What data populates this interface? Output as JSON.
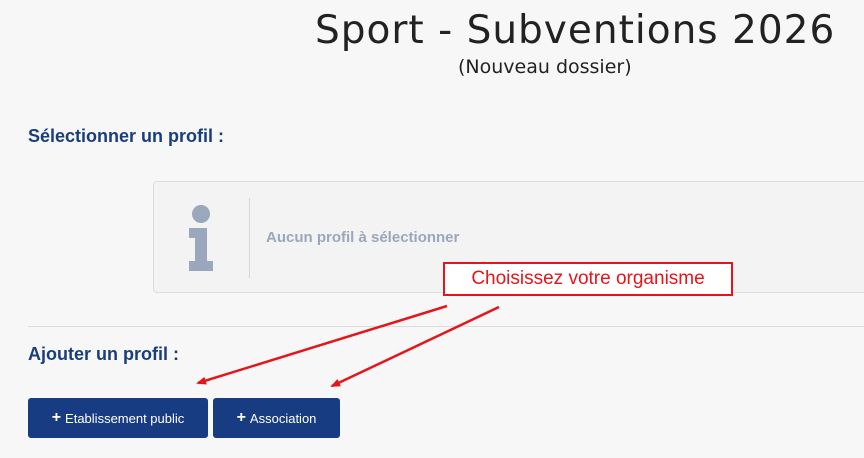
{
  "header": {
    "title": "Sport - Subventions 2026",
    "subtitle": "(Nouveau dossier)"
  },
  "select_profile": {
    "heading": "Sélectionner un profil :",
    "empty_message": "Aucun profil à sélectionner",
    "icon": "info-icon"
  },
  "add_profile": {
    "heading": "Ajouter un profil :",
    "buttons": [
      {
        "label": "Etablissement public",
        "icon": "plus-icon"
      },
      {
        "label": "Association",
        "icon": "plus-icon"
      }
    ]
  },
  "annotation": {
    "callout_text": "Choisissez votre organisme",
    "color": "#e3161b"
  },
  "colors": {
    "brand": "#173c82",
    "heading": "#1a3e7a",
    "muted": "#9aa7bc"
  }
}
